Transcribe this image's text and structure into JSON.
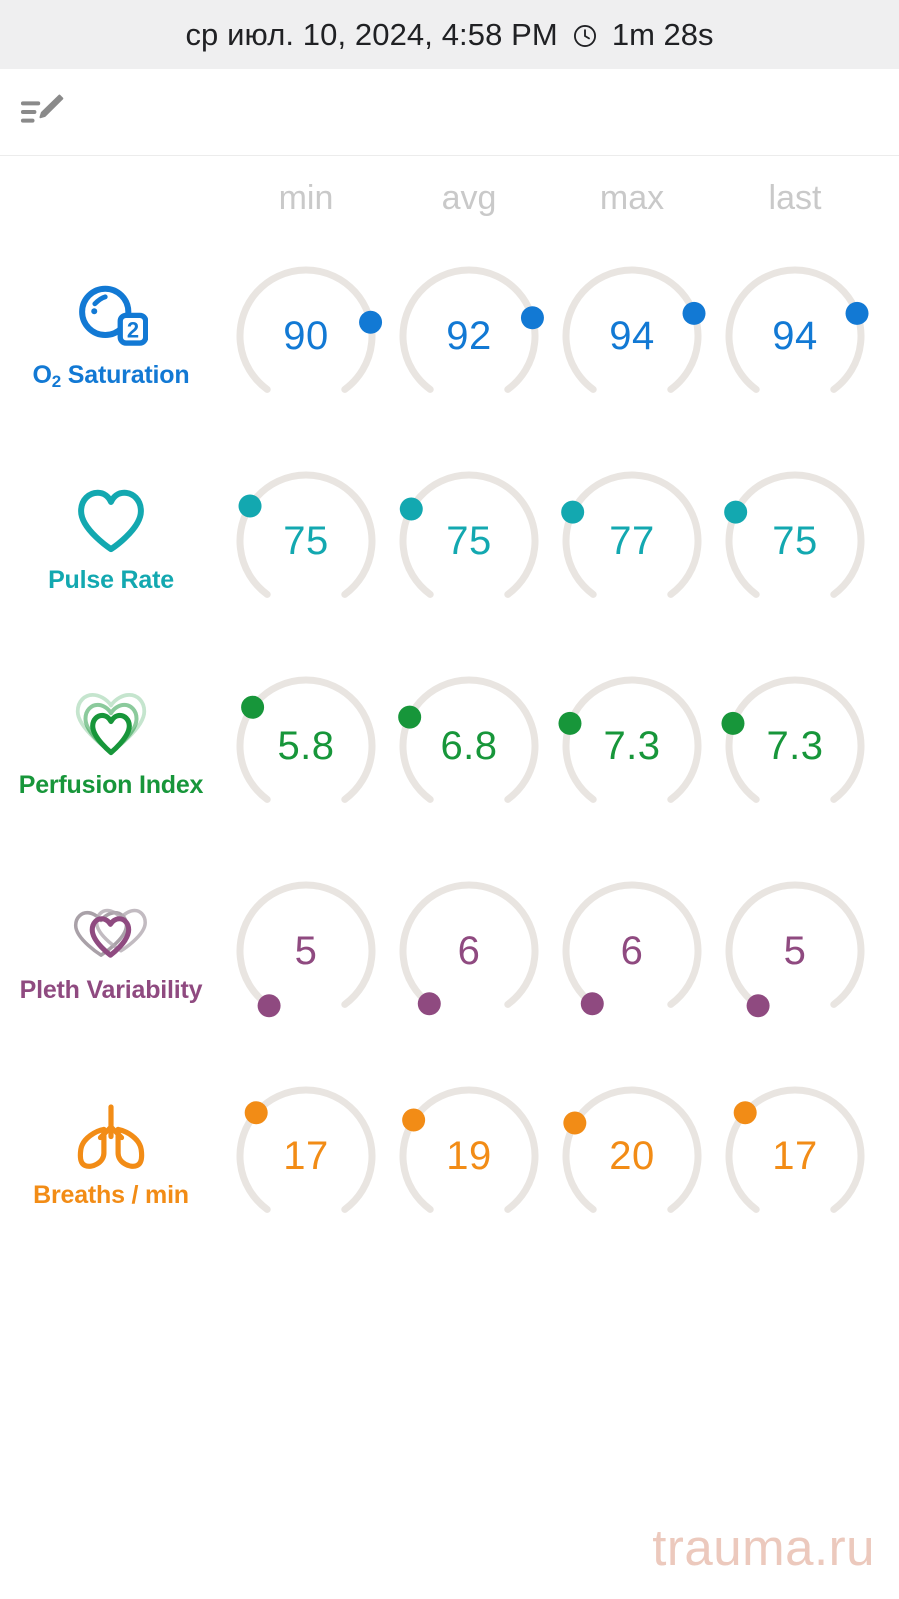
{
  "header": {
    "datetime": "ср июл. 10, 2024, 4:58 PM",
    "clock_icon": "clock-icon",
    "duration": "1m 28s",
    "background": "#efeff0"
  },
  "note": {
    "icon": "note-edit-icon"
  },
  "columns": [
    {
      "label": "min"
    },
    {
      "label": "avg"
    },
    {
      "label": "max"
    },
    {
      "label": "last"
    }
  ],
  "metrics": [
    {
      "id": "o2-saturation",
      "label": "O",
      "label_sub": "2",
      "label_rest": " Saturation",
      "icon": "o2-bubble-icon",
      "color": "#1279d4",
      "values": [
        "90",
        "92",
        "94",
        "94"
      ],
      "dot_angles": [
        78,
        74,
        70,
        70
      ]
    },
    {
      "id": "pulse-rate",
      "label": "Pulse Rate",
      "icon": "heart-outline-icon",
      "color": "#13a8b0",
      "values": [
        "75",
        "75",
        "77",
        "75"
      ],
      "dot_angles": [
        -58,
        -61,
        -64,
        -64
      ]
    },
    {
      "id": "perfusion-index",
      "label": "Perfusion Index",
      "icon": "nested-hearts-icon",
      "color": "#17963a",
      "values": [
        "5.8",
        "6.8",
        "7.3",
        "7.3"
      ],
      "dot_angles": [
        -54,
        -64,
        -70,
        -70
      ]
    },
    {
      "id": "pleth-variability",
      "label": "Pleth Variability",
      "icon": "overlapping-hearts-icon",
      "color": "#8f4a80",
      "values": [
        "5",
        "6",
        "6",
        "5"
      ],
      "dot_angles": [
        -146,
        -143,
        -143,
        -146
      ]
    },
    {
      "id": "breaths-per-min",
      "label": "Breaths / min",
      "icon": "lungs-icon",
      "color": "#f28c16",
      "values": [
        "17",
        "19",
        "20",
        "17"
      ],
      "dot_angles": [
        -49,
        -57,
        -60,
        -49
      ]
    }
  ],
  "gauge_track_color": "#e9e5e1",
  "watermark": {
    "text": "trauma.ru",
    "color": "#ecc9bd"
  }
}
